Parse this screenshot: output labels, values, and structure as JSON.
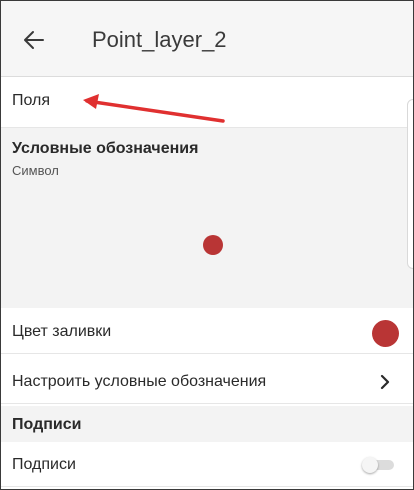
{
  "header": {
    "back_icon": "arrow-left-icon",
    "title": "Point_layer_2"
  },
  "fields": {
    "label": "Поля"
  },
  "legend": {
    "title": "Условные обозначения",
    "subtitle": "Символ",
    "symbol_color": "#b93535"
  },
  "fill": {
    "label": "Цвет заливки",
    "color": "#b93535"
  },
  "customize": {
    "label": "Настроить условные обозначения",
    "icon": "chevron-right-icon"
  },
  "labels_section": {
    "title": "Подписи"
  },
  "labels_toggle": {
    "label": "Подписи",
    "enabled": false
  },
  "annotation": {
    "color": "#e03030",
    "icon": "arrow-annotation"
  }
}
